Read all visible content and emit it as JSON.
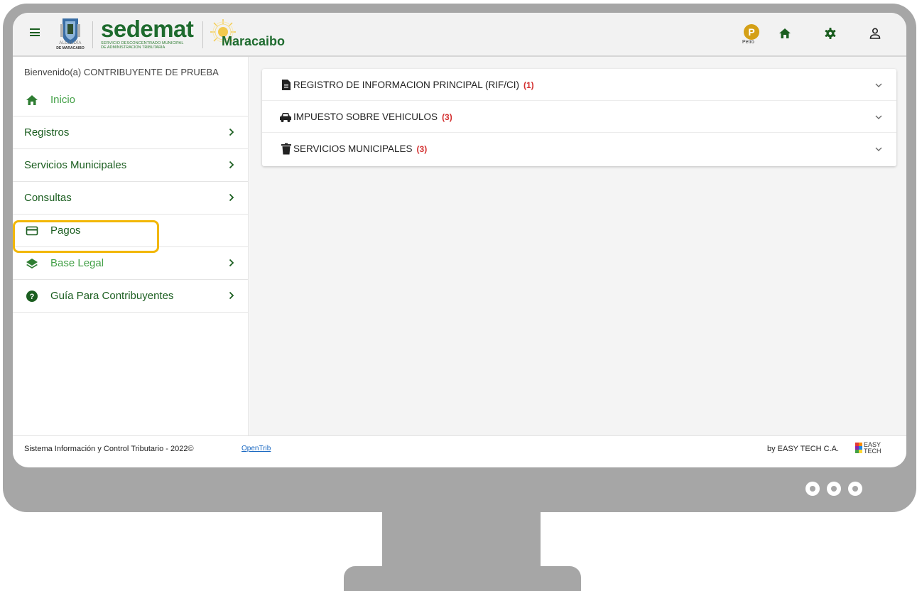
{
  "header": {
    "crest_caption_line1": "ALCALDÍA",
    "crest_caption_line2": "DE MARACAIBO",
    "brand_name": "sedemat",
    "brand_subtitle_line1": "SERVICIO DESCONCENTRADO MUNICIPAL",
    "brand_subtitle_line2": "DE ADMINISTRACION TRIBUTARIA",
    "city_name": "Maracaibo",
    "petro_symbol": "P",
    "petro_label": "Petro",
    "icons": [
      "menu-icon",
      "petro-icon",
      "home-icon",
      "gear-icon",
      "user-icon"
    ]
  },
  "sidebar": {
    "welcome": "Bienvenido(a) CONTRIBUYENTE DE PRUEBA",
    "items": [
      {
        "label": "Inicio",
        "icon": "home-icon"
      },
      {
        "label": "Registros"
      },
      {
        "label": "Servicios Municipales"
      },
      {
        "label": "Consultas"
      },
      {
        "label": "Pagos",
        "icon": "credit-card-icon"
      },
      {
        "label": "Base Legal",
        "icon": "layers-icon"
      },
      {
        "label": "Guía Para Contribuyentes",
        "icon": "help-icon"
      }
    ],
    "highlighted_item": "Pagos",
    "highlight_color": "#f2b705"
  },
  "main": {
    "sections": [
      {
        "title": "REGISTRO DE INFORMACION PRINCIPAL (RIF/CI)",
        "count": "(1)",
        "icon": "document-icon"
      },
      {
        "title": "IMPUESTO SOBRE VEHICULOS",
        "count": "(3)",
        "icon": "car-icon"
      },
      {
        "title": "SERVICIOS MUNICIPALES",
        "count": "(3)",
        "icon": "trash-icon"
      }
    ]
  },
  "footer": {
    "text": "Sistema Información y Control Tributario -  2022©",
    "opentrib": "OpenTrib",
    "byline": "by EASY TECH C.A.",
    "logo_line1": "EASY",
    "logo_line2": "TECH"
  },
  "colors": {
    "brand_green": "#1e6b2e",
    "light_green": "#43a047",
    "count_red": "#d32f2f",
    "monitor_gray": "#a6a6a6"
  }
}
